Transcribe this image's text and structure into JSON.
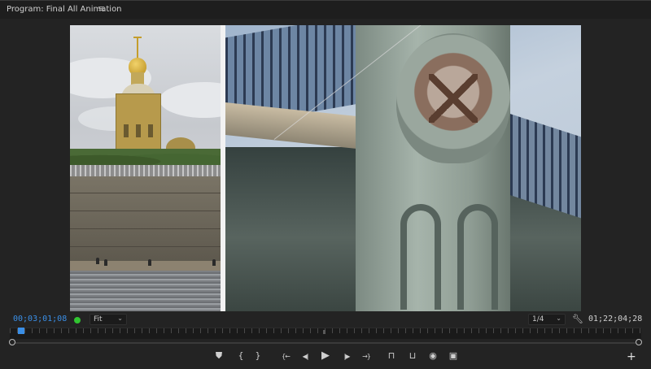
{
  "panel": {
    "title": "Program: Final All Animation",
    "menu_icon": "hamburger-menu-icon"
  },
  "controls": {
    "current_timecode": "00;03;01;08",
    "status_indicator_color": "#31c531",
    "zoom_select": "Fit",
    "resolution_select": "1/4",
    "duration_timecode": "01;22;04;28",
    "settings_icon": "wrench-icon",
    "accent_color": "#3a8ee6"
  },
  "transport": [
    {
      "name": "add-marker-button",
      "icon": "marker-icon",
      "glyph": "⛊"
    },
    {
      "name": "mark-in-button",
      "icon": "mark-in-icon",
      "glyph": "{"
    },
    {
      "name": "mark-out-button",
      "icon": "mark-out-icon",
      "glyph": "}"
    },
    {
      "name": "go-to-in-button",
      "icon": "go-to-in-icon",
      "glyph": "{←"
    },
    {
      "name": "step-back-button",
      "icon": "step-back-icon",
      "glyph": "◀|"
    },
    {
      "name": "play-button",
      "icon": "play-icon",
      "glyph": "▶"
    },
    {
      "name": "step-forward-button",
      "icon": "step-forward-icon",
      "glyph": "|▶"
    },
    {
      "name": "go-to-out-button",
      "icon": "go-to-out-icon",
      "glyph": "→}"
    },
    {
      "name": "lift-button",
      "icon": "lift-icon",
      "glyph": "⊓"
    },
    {
      "name": "extract-button",
      "icon": "extract-icon",
      "glyph": "⊔"
    },
    {
      "name": "export-frame-button",
      "icon": "camera-icon",
      "glyph": "◉"
    },
    {
      "name": "comparison-view-button",
      "icon": "comparison-icon",
      "glyph": "▣"
    }
  ],
  "add_button_glyph": "+"
}
